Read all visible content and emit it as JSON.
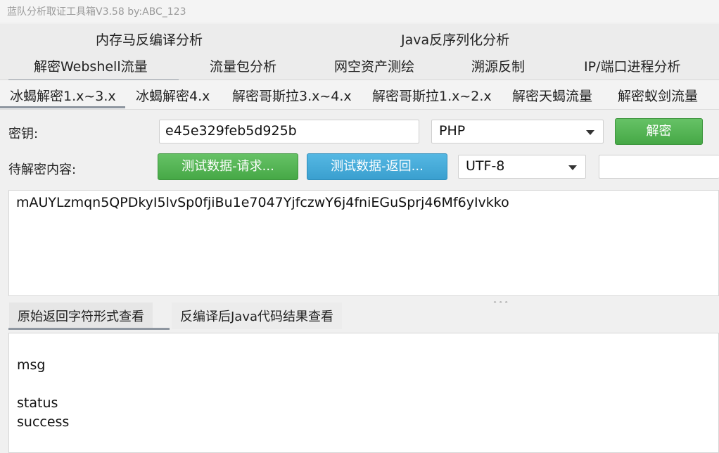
{
  "window": {
    "title": "蓝队分析取证工具箱V3.58 by:ABC_123"
  },
  "top_tabs": [
    "内存马反编译分析",
    "Java反序列化分析"
  ],
  "main_tabs": [
    "解密Webshell流量",
    "流量包分析",
    "网空资产测绘",
    "溯源反制",
    "IP/端口进程分析"
  ],
  "sub_tabs": [
    "冰蝎解密1.x~3.x",
    "冰蝎解密4.x",
    "解密哥斯拉3.x~4.x",
    "解密哥斯拉1.x~2.x",
    "解密天蝎流量",
    "解密蚁剑流量"
  ],
  "form": {
    "key_label": "密钥:",
    "key_value": "e45e329feb5d925b",
    "lang_selected": "PHP",
    "decrypt_button": "解密",
    "content_label": "待解密内容:",
    "test_request_button": "测试数据-请求...",
    "test_response_button": "测试数据-返回...",
    "encoding_selected": "UTF-8",
    "extra_input_value": ""
  },
  "input_content": "mAUYLzmqn5QPDkyI5lvSp0fjiBu1e7047YjfczwY6j4fniEGuSprj46Mf6yIvkko",
  "result_tabs": [
    "原始返回字符形式查看",
    "反编译后Java代码结果查看"
  ],
  "output_lines": [
    "msg",
    "",
    "status",
    "success"
  ],
  "colors": {
    "green_button": "#4cae4c",
    "blue_button": "#3ba5d4",
    "tab_indicator": "#8e96a0"
  }
}
